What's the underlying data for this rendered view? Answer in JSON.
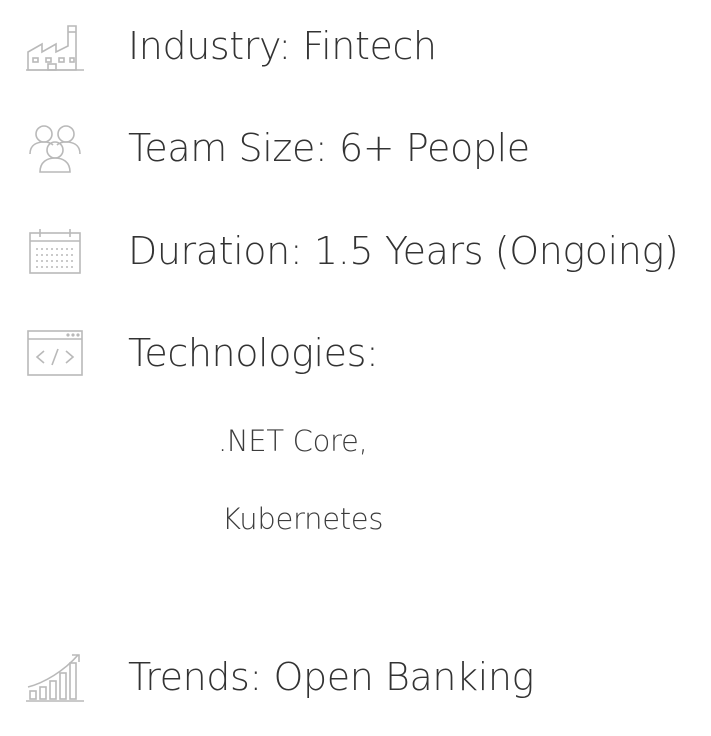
{
  "items": [
    {
      "icon": "factory-icon",
      "label": "Industry: Fintech"
    },
    {
      "icon": "team-icon",
      "label": "Team Size: 6+ People"
    },
    {
      "icon": "calendar-icon",
      "label": "Duration: 1.5 Years (Ongoing)"
    },
    {
      "icon": "code-window-icon",
      "label": "Technologies:"
    },
    {
      "icon": "growth-chart-icon",
      "label": "Trends: Open Banking"
    }
  ],
  "technologies": [
    ".NET Core,",
    "Kubernetes"
  ],
  "colors": {
    "text": "#333333",
    "icon_stroke": "#b9b9b9"
  }
}
